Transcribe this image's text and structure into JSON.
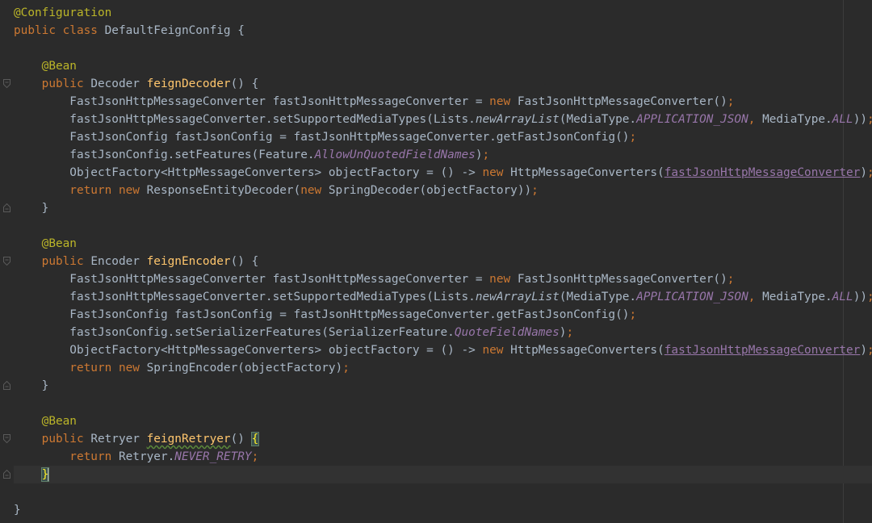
{
  "editor": {
    "language": "Java",
    "theme": "Darcula",
    "colors": {
      "background": "#2b2b2b",
      "keyword": "#cc7832",
      "annotation": "#bbb529",
      "method_declaration": "#ffc66d",
      "static_field": "#9876aa",
      "plain": "#a9b7c6"
    },
    "lines": [
      [
        {
          "t": "@Configuration",
          "c": "a"
        }
      ],
      [
        {
          "t": "public class ",
          "c": "k"
        },
        {
          "t": "DefaultFeignConfig {",
          "c": "p"
        }
      ],
      [],
      [
        {
          "t": "    @Bean",
          "c": "a"
        }
      ],
      [
        {
          "t": "    public ",
          "c": "k"
        },
        {
          "t": "Decoder ",
          "c": "p"
        },
        {
          "t": "feignDecoder",
          "c": "f"
        },
        {
          "t": "() {",
          "c": "p"
        }
      ],
      [
        {
          "t": "        FastJsonHttpMessageConverter fastJsonHttpMessageConverter = ",
          "c": "p"
        },
        {
          "t": "new ",
          "c": "k"
        },
        {
          "t": "FastJsonHttpMessageConverter()",
          "c": "p"
        },
        {
          "t": ";",
          "c": "k"
        }
      ],
      [
        {
          "t": "        fastJsonHttpMessageConverter.setSupportedMediaTypes(Lists.",
          "c": "p"
        },
        {
          "t": "newArrayList",
          "c": "it"
        },
        {
          "t": "(MediaType.",
          "c": "p"
        },
        {
          "t": "APPLICATION_JSON",
          "c": "s"
        },
        {
          "t": ", ",
          "c": "k"
        },
        {
          "t": "MediaType.",
          "c": "p"
        },
        {
          "t": "ALL",
          "c": "s"
        },
        {
          "t": "))",
          "c": "p"
        },
        {
          "t": ";",
          "c": "k"
        }
      ],
      [
        {
          "t": "        FastJsonConfig fastJsonConfig = fastJsonHttpMessageConverter.getFastJsonConfig()",
          "c": "p"
        },
        {
          "t": ";",
          "c": "k"
        }
      ],
      [
        {
          "t": "        fastJsonConfig.setFeatures(Feature.",
          "c": "p"
        },
        {
          "t": "AllowUnQuotedFieldNames",
          "c": "s"
        },
        {
          "t": ")",
          "c": "p"
        },
        {
          "t": ";",
          "c": "k"
        }
      ],
      [
        {
          "t": "        ObjectFactory<HttpMessageConverters> objectFactory = () -> ",
          "c": "p"
        },
        {
          "t": "new ",
          "c": "k"
        },
        {
          "t": "HttpMessageConverters(",
          "c": "p"
        },
        {
          "t": "fastJsonHttpMessageConverter",
          "c": "u"
        },
        {
          "t": ")",
          "c": "p"
        },
        {
          "t": ";",
          "c": "k"
        }
      ],
      [
        {
          "t": "        return new ",
          "c": "k"
        },
        {
          "t": "ResponseEntityDecoder(",
          "c": "p"
        },
        {
          "t": "new ",
          "c": "k"
        },
        {
          "t": "SpringDecoder(objectFactory))",
          "c": "p"
        },
        {
          "t": ";",
          "c": "k"
        }
      ],
      [
        {
          "t": "    }",
          "c": "p"
        }
      ],
      [],
      [
        {
          "t": "    @Bean",
          "c": "a"
        }
      ],
      [
        {
          "t": "    public ",
          "c": "k"
        },
        {
          "t": "Encoder ",
          "c": "p"
        },
        {
          "t": "feignEncoder",
          "c": "f"
        },
        {
          "t": "() {",
          "c": "p"
        }
      ],
      [
        {
          "t": "        FastJsonHttpMessageConverter fastJsonHttpMessageConverter = ",
          "c": "p"
        },
        {
          "t": "new ",
          "c": "k"
        },
        {
          "t": "FastJsonHttpMessageConverter()",
          "c": "p"
        },
        {
          "t": ";",
          "c": "k"
        }
      ],
      [
        {
          "t": "        fastJsonHttpMessageConverter.setSupportedMediaTypes(Lists.",
          "c": "p"
        },
        {
          "t": "newArrayList",
          "c": "it"
        },
        {
          "t": "(MediaType.",
          "c": "p"
        },
        {
          "t": "APPLICATION_JSON",
          "c": "s"
        },
        {
          "t": ", ",
          "c": "k"
        },
        {
          "t": "MediaType.",
          "c": "p"
        },
        {
          "t": "ALL",
          "c": "s"
        },
        {
          "t": "))",
          "c": "p"
        },
        {
          "t": ";",
          "c": "k"
        }
      ],
      [
        {
          "t": "        FastJsonConfig fastJsonConfig = fastJsonHttpMessageConverter.getFastJsonConfig()",
          "c": "p"
        },
        {
          "t": ";",
          "c": "k"
        }
      ],
      [
        {
          "t": "        fastJsonConfig.setSerializerFeatures(SerializerFeature.",
          "c": "p"
        },
        {
          "t": "QuoteFieldNames",
          "c": "s"
        },
        {
          "t": ")",
          "c": "p"
        },
        {
          "t": ";",
          "c": "k"
        }
      ],
      [
        {
          "t": "        ObjectFactory<HttpMessageConverters> objectFactory = () -> ",
          "c": "p"
        },
        {
          "t": "new ",
          "c": "k"
        },
        {
          "t": "HttpMessageConverters(",
          "c": "p"
        },
        {
          "t": "fastJsonHttpMessageConverter",
          "c": "u"
        },
        {
          "t": ")",
          "c": "p"
        },
        {
          "t": ";",
          "c": "k"
        }
      ],
      [
        {
          "t": "        return new ",
          "c": "k"
        },
        {
          "t": "SpringEncoder(objectFactory)",
          "c": "p"
        },
        {
          "t": ";",
          "c": "k"
        }
      ],
      [
        {
          "t": "    }",
          "c": "p"
        }
      ],
      [],
      [
        {
          "t": "    @Bean",
          "c": "a"
        }
      ],
      [
        {
          "t": "    public ",
          "c": "k"
        },
        {
          "t": "Retryer ",
          "c": "p"
        },
        {
          "t": "feignRetryer",
          "c": "f squiggle"
        },
        {
          "t": "() ",
          "c": "p"
        },
        {
          "t": "{",
          "c": "p brace-match"
        }
      ],
      [
        {
          "t": "        return ",
          "c": "k"
        },
        {
          "t": "Retryer.",
          "c": "p"
        },
        {
          "t": "NEVER_RETRY",
          "c": "s"
        },
        {
          "t": ";",
          "c": "k"
        }
      ],
      [
        {
          "t": "    ",
          "c": "p"
        },
        {
          "t": "}",
          "c": "p brace-match caret-after"
        }
      ],
      [],
      [
        {
          "t": "}",
          "c": "p"
        }
      ]
    ],
    "current_line": 26,
    "fold_markers": [
      {
        "line": 4,
        "kind": "open"
      },
      {
        "line": 11,
        "kind": "close"
      },
      {
        "line": 14,
        "kind": "open"
      },
      {
        "line": 21,
        "kind": "close"
      },
      {
        "line": 24,
        "kind": "open"
      },
      {
        "line": 26,
        "kind": "close"
      }
    ]
  }
}
